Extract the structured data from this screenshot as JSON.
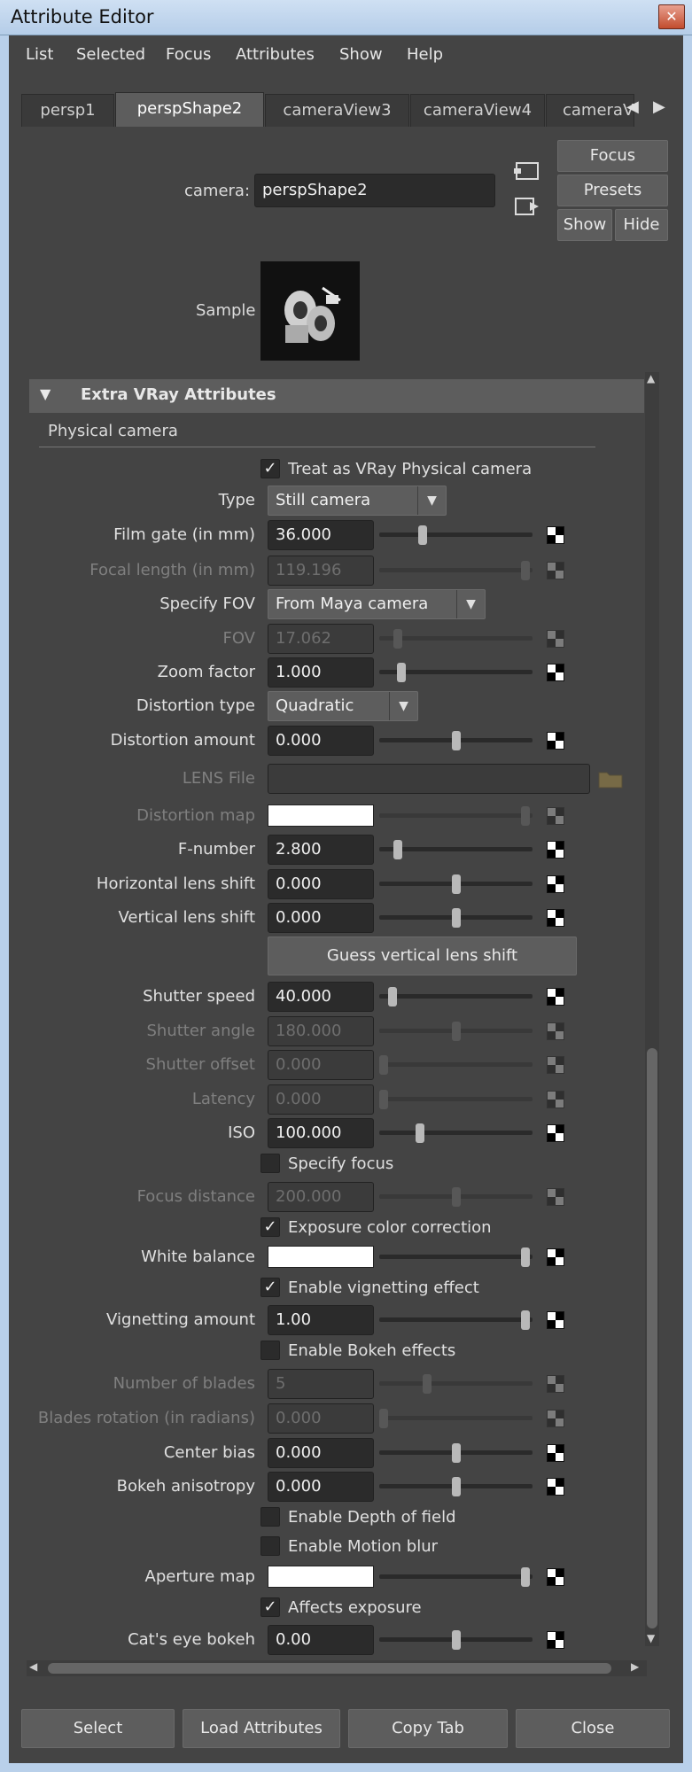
{
  "window": {
    "title": "Attribute Editor",
    "close_glyph": "✕"
  },
  "menu": [
    "List",
    "Selected",
    "Focus",
    "Attributes",
    "Show",
    "Help"
  ],
  "tabs": [
    "persp1",
    "perspShape2",
    "cameraView3",
    "cameraView4",
    "cameraV"
  ],
  "tab_arrows": {
    "left": "◀",
    "right": "▶"
  },
  "header": {
    "camera_label": "camera:",
    "camera_value": "perspShape2",
    "sample_label": "Sample",
    "focus": "Focus",
    "presets": "Presets",
    "show": "Show",
    "hide": "Hide"
  },
  "section": {
    "title": "Extra VRay Attributes",
    "collapse_glyph": "▼",
    "subsection": "Physical camera"
  },
  "attributes": {
    "treat_physical": {
      "label": "Treat as VRay Physical camera",
      "checked": true
    },
    "type": {
      "label": "Type",
      "value": "Still camera"
    },
    "film_gate": {
      "label": "Film gate (in mm)",
      "value": "36.000",
      "level": 0.27
    },
    "focal_length": {
      "label": "Focal length (in mm)",
      "value": "119.196",
      "level": 0.98
    },
    "specify_fov": {
      "label": "Specify FOV",
      "value": "From Maya camera"
    },
    "fov": {
      "label": "FOV",
      "value": "17.062",
      "level": 0.1
    },
    "zoom_factor": {
      "label": "Zoom factor",
      "value": "1.000",
      "level": 0.12
    },
    "distortion_type": {
      "label": "Distortion type",
      "value": "Quadratic"
    },
    "distortion_amount": {
      "label": "Distortion amount",
      "value": "0.000",
      "level": 0.5
    },
    "lens_file": {
      "label": "LENS File"
    },
    "distortion_map": {
      "label": "Distortion map",
      "level": 0.98
    },
    "f_number": {
      "label": "F-number",
      "value": "2.800",
      "level": 0.1
    },
    "h_lens_shift": {
      "label": "Horizontal lens shift",
      "value": "0.000",
      "level": 0.5
    },
    "v_lens_shift": {
      "label": "Vertical lens shift",
      "value": "0.000",
      "level": 0.5
    },
    "guess_button": "Guess vertical lens shift",
    "shutter_speed": {
      "label": "Shutter speed",
      "value": "40.000",
      "level": 0.06
    },
    "shutter_angle": {
      "label": "Shutter angle",
      "value": "180.000",
      "level": 0.5
    },
    "shutter_offset": {
      "label": "Shutter offset",
      "value": "0.000",
      "level": 0.0
    },
    "latency": {
      "label": "Latency",
      "value": "0.000",
      "level": 0.0
    },
    "iso": {
      "label": "ISO",
      "value": "100.000",
      "level": 0.25
    },
    "specify_focus": {
      "label": "Specify focus",
      "checked": false
    },
    "focus_distance": {
      "label": "Focus distance",
      "value": "200.000",
      "level": 0.5
    },
    "exposure_cc": {
      "label": "Exposure color correction",
      "checked": true
    },
    "white_balance": {
      "label": "White balance",
      "level": 0.98
    },
    "enable_vignetting": {
      "label": "Enable vignetting effect",
      "checked": true
    },
    "vignetting_amount": {
      "label": "Vignetting amount",
      "value": "1.00",
      "level": 0.98
    },
    "enable_bokeh": {
      "label": "Enable Bokeh effects",
      "checked": false
    },
    "num_blades": {
      "label": "Number of blades",
      "value": "5",
      "level": 0.3
    },
    "blades_rotation": {
      "label": "Blades rotation (in radians)",
      "value": "0.000",
      "level": 0.0
    },
    "center_bias": {
      "label": "Center bias",
      "value": "0.000",
      "level": 0.5
    },
    "bokeh_anisotropy": {
      "label": "Bokeh anisotropy",
      "value": "0.000",
      "level": 0.5
    },
    "enable_dof": {
      "label": "Enable Depth of field",
      "checked": false
    },
    "enable_motion_blur": {
      "label": "Enable Motion blur",
      "checked": false
    },
    "aperture_map": {
      "label": "Aperture map",
      "level": 0.98
    },
    "affects_exposure": {
      "label": "Affects exposure",
      "checked": true
    },
    "cats_eye": {
      "label": "Cat's eye bokeh",
      "value": "0.00",
      "level": 0.5
    }
  },
  "bottom_buttons": [
    "Select",
    "Load Attributes",
    "Copy Tab",
    "Close"
  ],
  "colors": {
    "panel": "#444444",
    "field": "#2b2b2b",
    "button": "#5d5d5d",
    "title_bar": "#b5cde8"
  },
  "icons": [
    "close-icon",
    "collapse-arrow-icon",
    "select-node-icon",
    "load-camera-icon",
    "folder-icon",
    "map-button-icon",
    "checkmark-icon",
    "dropdown-arrow-icon"
  ]
}
